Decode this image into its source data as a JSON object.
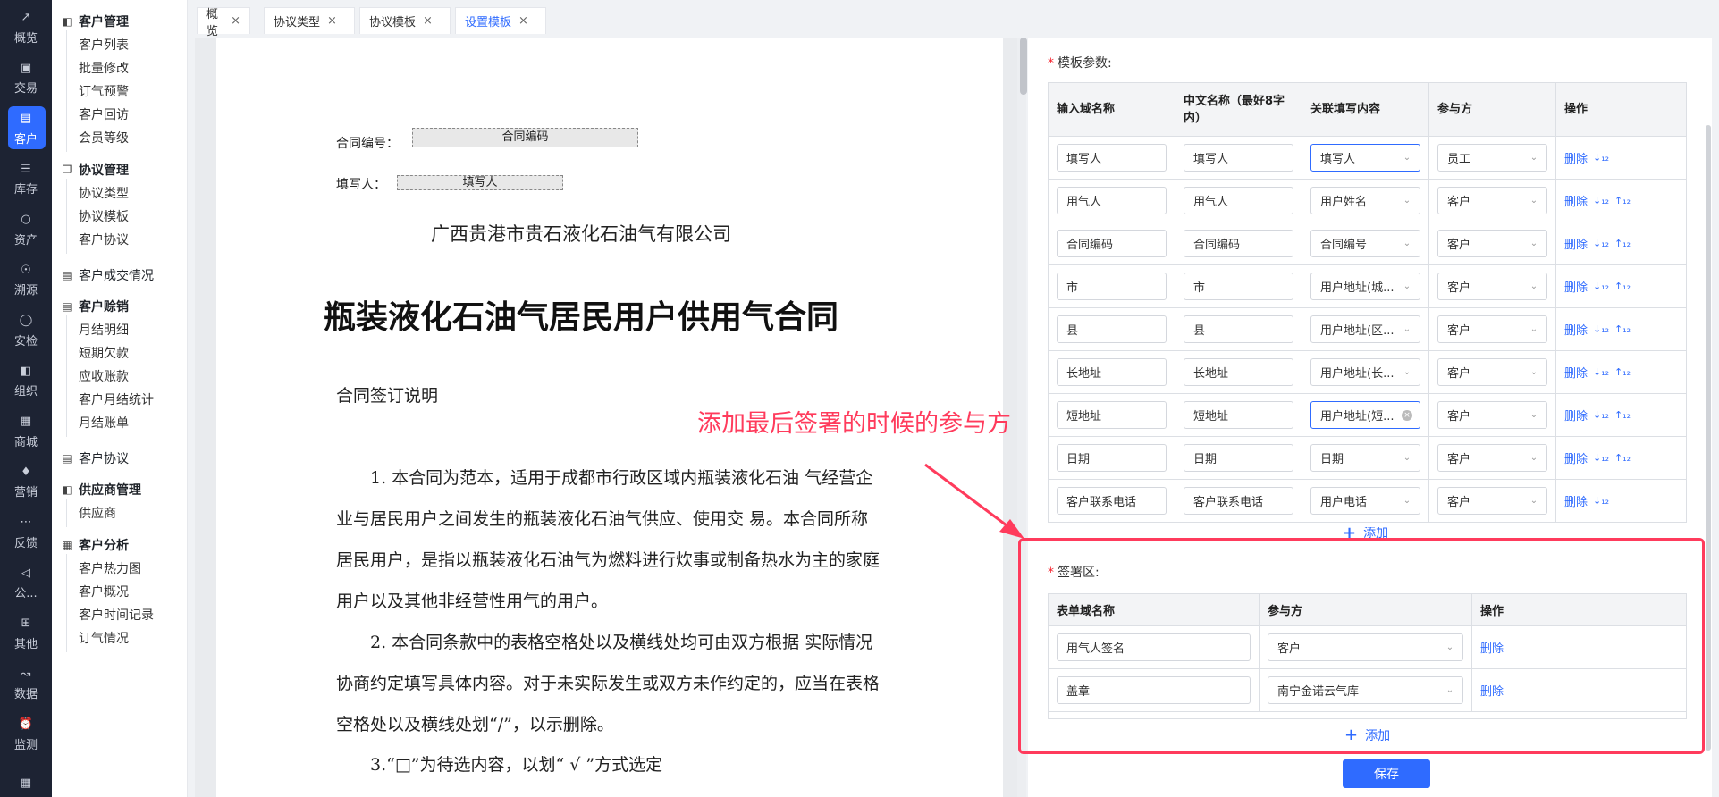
{
  "colors": {
    "accent": "#2f6bff",
    "annotation": "#ff3b5c",
    "rail_bg": "#1d2333"
  },
  "rail": [
    {
      "label": "概览",
      "icon": "chart-line-icon"
    },
    {
      "label": "交易",
      "icon": "bag-icon"
    },
    {
      "label": "客户",
      "icon": "id-card-icon",
      "active": true
    },
    {
      "label": "库存",
      "icon": "list-icon"
    },
    {
      "label": "资产",
      "icon": "bulb-icon"
    },
    {
      "label": "溯源",
      "icon": "compass-icon"
    },
    {
      "label": "安检",
      "icon": "shield-icon"
    },
    {
      "label": "组织",
      "icon": "org-icon"
    },
    {
      "label": "商城",
      "icon": "store-icon"
    },
    {
      "label": "营销",
      "icon": "trophy-icon"
    },
    {
      "label": "反馈",
      "icon": "chat-icon"
    },
    {
      "label": "公...",
      "icon": "megaphone-icon"
    },
    {
      "label": "其他",
      "icon": "grid-add-icon"
    },
    {
      "label": "数据",
      "icon": "chart-icon"
    },
    {
      "label": "监测",
      "icon": "alarm-icon"
    },
    {
      "label": "",
      "icon": "apps-icon"
    }
  ],
  "menu": {
    "g1": "客户管理",
    "g1_items": [
      "客户列表",
      "批量修改",
      "订气预警",
      "客户回访",
      "会员等级"
    ],
    "g2": "协议管理",
    "g2_items": [
      "协议类型",
      "协议模板",
      "客户协议"
    ],
    "g3": "客户成交情况",
    "g4": "客户赊销",
    "g4_items": [
      "月结明细",
      "短期欠款",
      "应收账款",
      "客户月结统计",
      "月结账单"
    ],
    "g5": "客户协议",
    "g6": "供应商管理",
    "g6_items": [
      "供应商"
    ],
    "g7": "客户分析",
    "g7_items": [
      "客户热力图",
      "客户概况",
      "客户时间记录",
      "订气情况"
    ]
  },
  "tabs": [
    "概览",
    "协议类型",
    "协议模板",
    "设置模板"
  ],
  "doc": {
    "contract_no_label": "合同编号：",
    "contract_no_field": "合同编码",
    "filler_label": "填写人：",
    "filler_field": "填写人",
    "company": "广西贵港市贵石液化石油气有限公司",
    "title": "瓶装液化石油气居民用户供用气合同",
    "section": "合同签订说明",
    "p1": "1. 本合同为范本，适用于成都市行政区域内瓶装液化石油 气经营企业与居民用户之间发生的瓶装液化石油气供应、使用交 易。本合同所称居民用户，是指以瓶装液化石油气为燃料进行炊事或制备热水为主的家庭用户以及其他非经营性用气的用户。",
    "p2": "2. 本合同条款中的表格空格处以及横线处均可由双方根据 实际情况协商约定填写具体内容。对于未实际发生或双方未作约定的，应当在表格空格处以及横线处划“/”，以示删除。",
    "p3": "3.“□”为待选内容，以划“ √ ”方式选定"
  },
  "annotation": "添加最后签署的时候的参与方",
  "params": {
    "label": "模板参数:",
    "headers": [
      "输入域名称",
      "中文名称（最好8字内）",
      "关联填写内容",
      "参与方",
      "操作"
    ],
    "rows": [
      {
        "field": "填写人",
        "cn": "填写人",
        "link": "填写人",
        "party": "员工",
        "link_focused": true,
        "sort_up": false
      },
      {
        "field": "用气人",
        "cn": "用气人",
        "link": "用户姓名",
        "party": "客户",
        "sort_up": true
      },
      {
        "field": "合同编码",
        "cn": "合同编码",
        "link": "合同编号",
        "party": "客户",
        "sort_up": true
      },
      {
        "field": "市",
        "cn": "市",
        "link": "用户地址(城...",
        "party": "客户",
        "sort_up": true
      },
      {
        "field": "县",
        "cn": "县",
        "link": "用户地址(区...",
        "party": "客户",
        "sort_up": true
      },
      {
        "field": "长地址",
        "cn": "长地址",
        "link": "用户地址(长...",
        "party": "客户",
        "sort_up": true
      },
      {
        "field": "短地址",
        "cn": "短地址",
        "link": "用户地址(短...",
        "party": "客户",
        "link_focused": true,
        "link_clear": true,
        "sort_up": true
      },
      {
        "field": "日期",
        "cn": "日期",
        "link": "日期",
        "party": "客户",
        "sort_up": true
      },
      {
        "field": "客户联系电话",
        "cn": "客户联系电话",
        "link": "用户电话",
        "party": "客户",
        "sort_up": false,
        "last": true
      }
    ],
    "delete": "删除",
    "add": "添加"
  },
  "sign": {
    "label": "签署区:",
    "headers": [
      "表单域名称",
      "参与方",
      "操作"
    ],
    "rows": [
      {
        "field": "用气人签名",
        "party": "客户"
      },
      {
        "field": "盖章",
        "party": "南宁金诺云气库"
      }
    ],
    "delete": "删除",
    "add": "添加"
  },
  "save": "保存"
}
